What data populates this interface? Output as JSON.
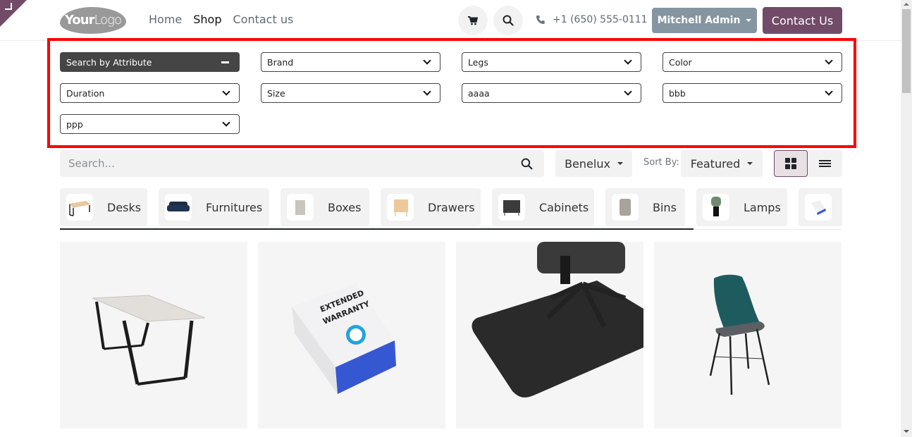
{
  "header": {
    "logo_bold": "Your",
    "logo_light": "Logo",
    "nav": [
      {
        "label": "Home",
        "active": false
      },
      {
        "label": "Shop",
        "active": true
      },
      {
        "label": "Contact us",
        "active": false
      }
    ],
    "cart_icon": "cart-icon",
    "search_icon": "search-icon",
    "phone": "+1 (650) 555-0111",
    "user_menu": "Mitchell Admin",
    "cta": "Contact Us"
  },
  "attribute_filter": {
    "toggle_label": "Search by Attribute",
    "attributes": [
      "Brand",
      "Legs",
      "Color",
      "Duration",
      "Size",
      "aaaa",
      "bbb",
      "ppp"
    ]
  },
  "toolbar": {
    "search_placeholder": "Search...",
    "pricelist": "Benelux",
    "sort_label": "Sort By:",
    "sort_value": "Featured",
    "view_mode": "grid"
  },
  "categories": [
    {
      "label": "Desks"
    },
    {
      "label": "Furnitures"
    },
    {
      "label": "Boxes"
    },
    {
      "label": "Drawers"
    },
    {
      "label": "Cabinets"
    },
    {
      "label": "Bins"
    },
    {
      "label": "Lamps"
    },
    {
      "label": ""
    }
  ],
  "products": [
    {
      "image": "desk with black legs"
    },
    {
      "image": "extended warranty box"
    },
    {
      "image": "chair floor mat"
    },
    {
      "image": "teal dining chair"
    }
  ],
  "colors": {
    "brand": "#714b67",
    "user_button": "#8595a2",
    "highlight_border": "#ff0000",
    "dark_toggle": "#454545"
  }
}
